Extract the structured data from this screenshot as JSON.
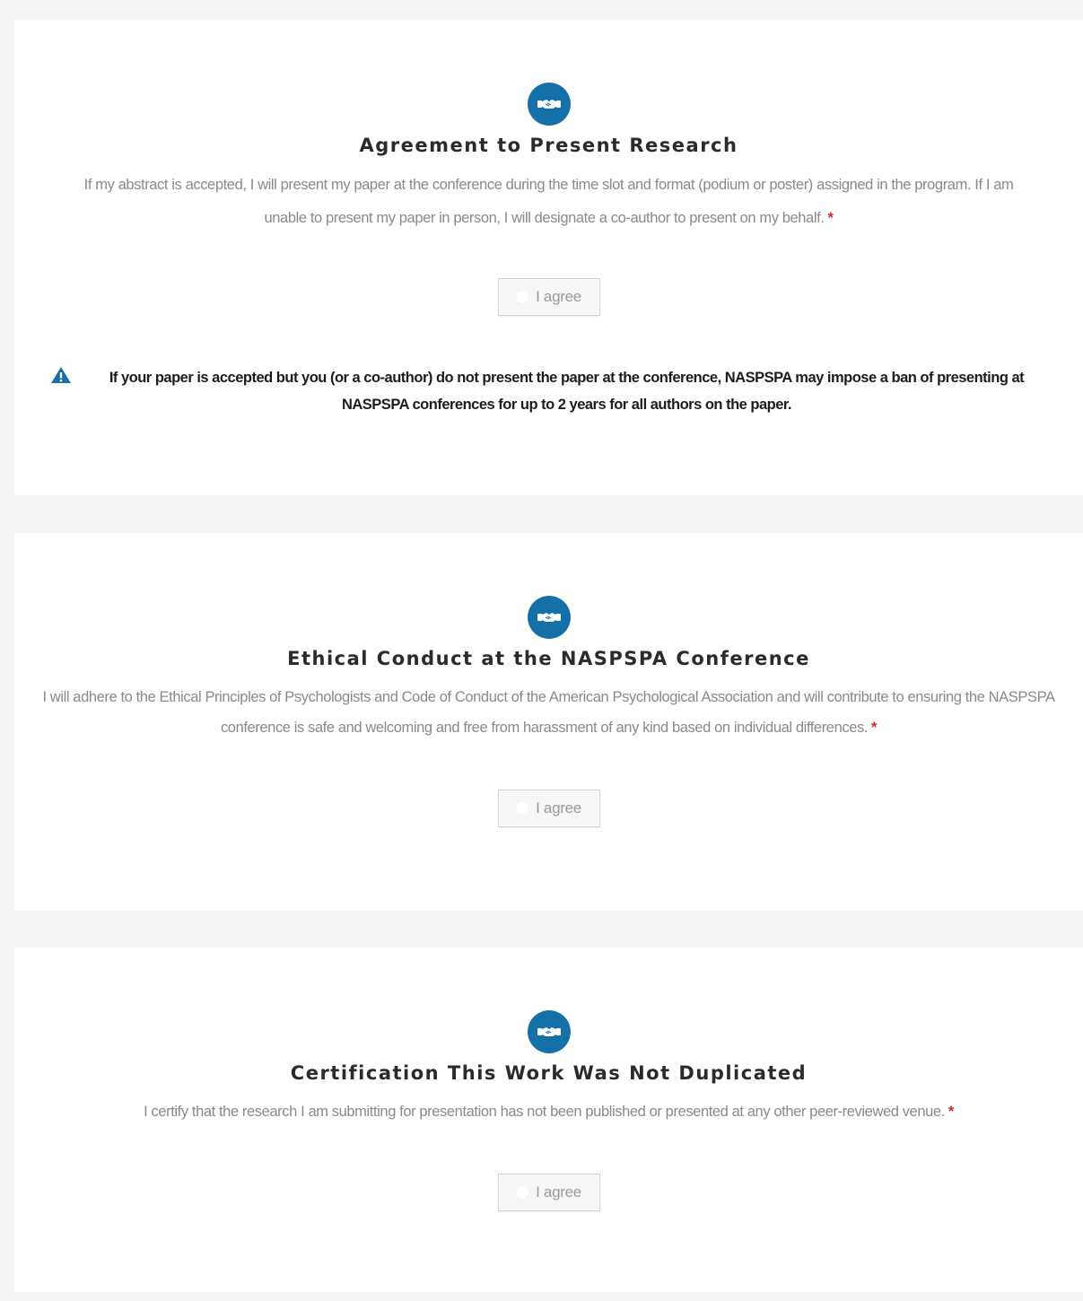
{
  "colors": {
    "accent": "#1670a8",
    "required": "#d9232e",
    "page_background": "#f4f4f4",
    "card_background": "#ffffff"
  },
  "sections": [
    {
      "icon": "handshake-icon",
      "title": "Agreement to Present Research",
      "description": "If my abstract is accepted, I will present my paper at the conference during the time slot and format (podium or poster) assigned in the program. If I am unable to present my paper in person, I will designate a co-author to present on my behalf.",
      "required_marker": "*",
      "agree_label": "I agree",
      "warning": {
        "icon": "warning-triangle-icon",
        "text": "If your paper is accepted but you (or a co-author) do not present the paper at the conference, NASPSPA may impose a ban of presenting at NASPSPA conferences for up to 2 years for all authors on the paper."
      }
    },
    {
      "icon": "handshake-icon",
      "title": "Ethical Conduct at the NASPSPA Conference",
      "description": "I will adhere to the Ethical Principles of Psychologists and Code of Conduct of the American Psychological Association and will contribute to ensuring the NASPSPA conference is safe and welcoming and free from harassment of any kind based on individual differences.",
      "required_marker": "*",
      "agree_label": "I agree"
    },
    {
      "icon": "handshake-icon",
      "title": "Certification This Work Was Not Duplicated",
      "description": "I certify that the research I am submitting for presentation has not been published or presented at any other peer-reviewed venue.",
      "required_marker": "*",
      "agree_label": "I agree"
    }
  ]
}
